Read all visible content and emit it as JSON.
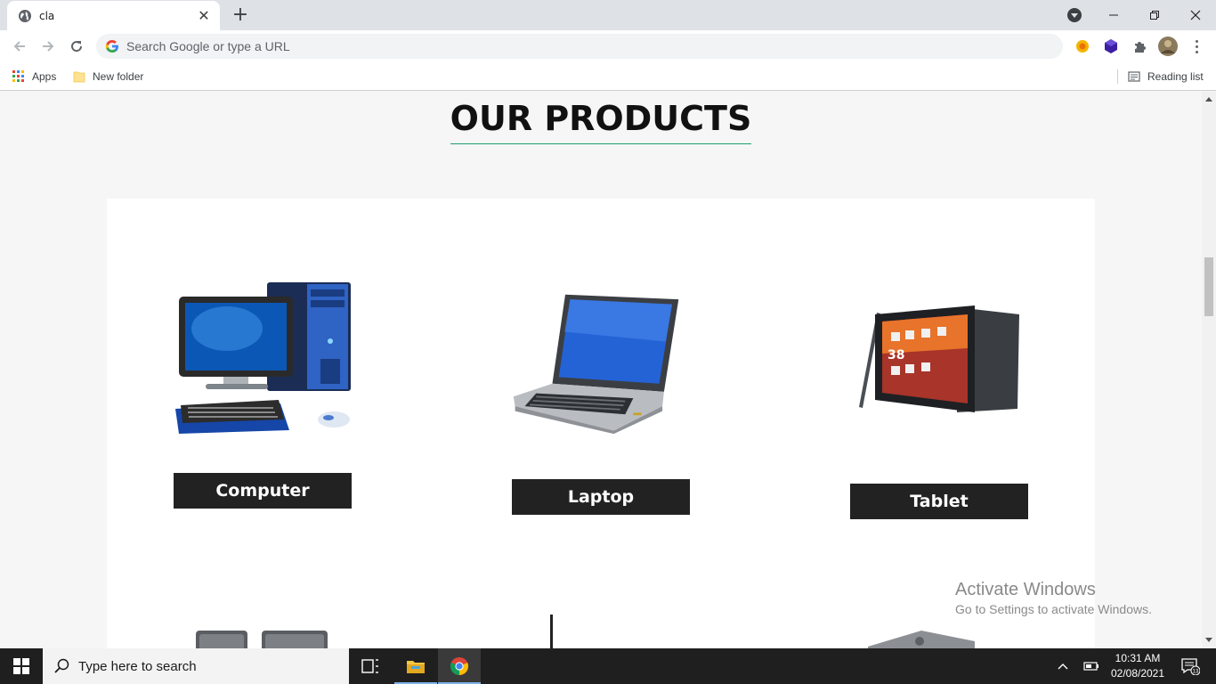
{
  "browser": {
    "tab_title": "cla",
    "omnibox_placeholder": "Search Google or type a URL",
    "bookmarks": {
      "apps_label": "Apps",
      "new_folder_label": "New folder",
      "reading_list_label": "Reading list"
    }
  },
  "page": {
    "section_title": "OUR PRODUCTS",
    "products": [
      {
        "label": "Computer",
        "icon": "desktop-computer"
      },
      {
        "label": "Laptop",
        "icon": "laptop"
      },
      {
        "label": "Tablet",
        "icon": "tablet"
      }
    ]
  },
  "watermark": {
    "line1": "Activate Windows",
    "line2": "Go to Settings to activate Windows."
  },
  "taskbar": {
    "search_placeholder": "Type here to search",
    "time": "10:31 AM",
    "date": "02/08/2021",
    "notification_count": "13"
  },
  "colors": {
    "title_underline": "#1f9e6b",
    "label_bg": "#222222",
    "taskbar_bg": "#1f1f1f"
  }
}
